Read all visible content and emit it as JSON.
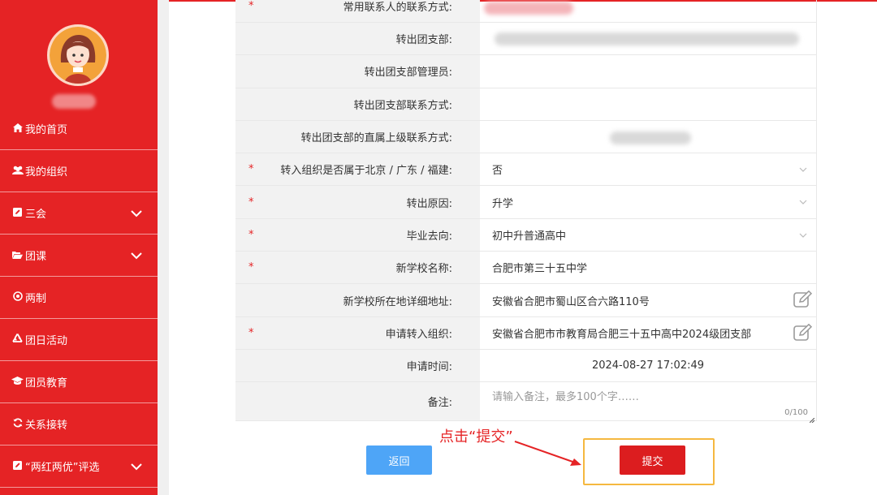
{
  "sidebar": {
    "items": [
      {
        "label": "我的首页",
        "icon": "home-icon",
        "has_chevron": false
      },
      {
        "label": "我的组织",
        "icon": "users-icon",
        "has_chevron": false
      },
      {
        "label": "三会",
        "icon": "edit-square-icon",
        "has_chevron": true
      },
      {
        "label": "团课",
        "icon": "folder-open-icon",
        "has_chevron": true
      },
      {
        "label": "两制",
        "icon": "target-icon",
        "has_chevron": false
      },
      {
        "label": "团日活动",
        "icon": "recycle-icon",
        "has_chevron": false
      },
      {
        "label": "团员教育",
        "icon": "graduation-cap-icon",
        "has_chevron": false
      },
      {
        "label": "关系接转",
        "icon": "refresh-icon",
        "has_chevron": false
      },
      {
        "label": "“两红两优”评选",
        "icon": "edit-square-icon",
        "has_chevron": true
      }
    ]
  },
  "form": {
    "rows": [
      {
        "label": "常用联系人的联系方式:",
        "required": true,
        "value": ""
      },
      {
        "label": "转出团支部:",
        "required": false,
        "value": ""
      },
      {
        "label": "转出团支部管理员:",
        "required": false,
        "value": ""
      },
      {
        "label": "转出团支部联系方式:",
        "required": false,
        "value": ""
      },
      {
        "label": "转出团支部的直属上级联系方式:",
        "required": false,
        "value": ""
      },
      {
        "label": "转入组织是否属于北京 / 广东 / 福建:",
        "required": true,
        "value": "否"
      },
      {
        "label": "转出原因:",
        "required": true,
        "value": "升学"
      },
      {
        "label": "毕业去向:",
        "required": true,
        "value": "初中升普通高中"
      },
      {
        "label": "新学校名称:",
        "required": true,
        "value": "合肥市第三十五中学"
      },
      {
        "label": "新学校所在地详细地址:",
        "required": false,
        "value": "安徽省合肥市蜀山区合六路110号"
      },
      {
        "label": "申请转入组织:",
        "required": true,
        "value": "安徽省合肥市市教育局合肥三十五中高中2024级团支部"
      },
      {
        "label": "申请时间:",
        "required": false,
        "value": "2024-08-27 17:02:49"
      }
    ],
    "remark": {
      "label": "备注:",
      "placeholder": "请输入备注，最多100个字……",
      "counter": "0/100"
    },
    "required_mark": "*"
  },
  "buttons": {
    "back": "返回",
    "submit": "提交"
  },
  "annotation": {
    "text": "点击“提交”",
    "color": "#e52325"
  },
  "colors": {
    "brand_red": "#e52325",
    "back_blue": "#4ea5f7",
    "highlight_orange": "#f5b840"
  }
}
